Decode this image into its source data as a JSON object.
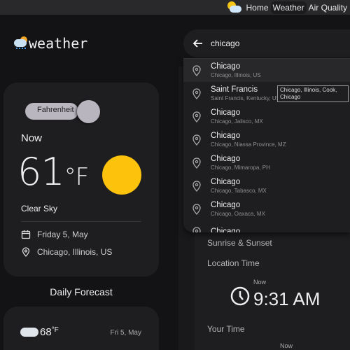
{
  "nav": {
    "items": [
      "Home",
      "Weather",
      "Air Quality"
    ],
    "active": "Weather"
  },
  "brand": {
    "name": "weather"
  },
  "current": {
    "unit_toggle": "Fahrenheit",
    "now_label": "Now",
    "temp": "61",
    "unit": "°F",
    "condition": "Clear Sky",
    "date": "Friday 5, May",
    "location": "Chicago, Illinois, US"
  },
  "daily": {
    "title": "Daily Forecast",
    "first": {
      "temp": "68",
      "unit": "°F",
      "date": "Fri 5, May"
    }
  },
  "search": {
    "value": "chicago"
  },
  "results": [
    {
      "name": "Chicago",
      "detail": "Chicago, Illinois, US"
    },
    {
      "name": "Saint Francis",
      "detail": "Saint Francis, Kentucky, US"
    },
    {
      "name": "Chicago",
      "detail": "Chicago, Jalisco, MX"
    },
    {
      "name": "Chicago",
      "detail": "Chicago, Niassa Province, MZ"
    },
    {
      "name": "Chicago",
      "detail": "Chicago, Mimaropa, PH"
    },
    {
      "name": "Chicago",
      "detail": "Chicago, Tabasco, MX"
    },
    {
      "name": "Chicago",
      "detail": "Chicago, Oaxaca, MX"
    },
    {
      "name": "Chicago",
      "detail": ""
    }
  ],
  "tooltip": "Chicago, Illinois, Cook, Chicago",
  "panel": {
    "sunrise_label": "Sunrise & Sunset",
    "location_time_label": "Location Time",
    "now_label": "Now",
    "location_time": "9:31 AM",
    "your_time_label": "Your Time",
    "now_label2": "Now"
  },
  "colors": {
    "sun": "#fdc20b",
    "bg": "#131315",
    "card": "#1e1e20"
  }
}
